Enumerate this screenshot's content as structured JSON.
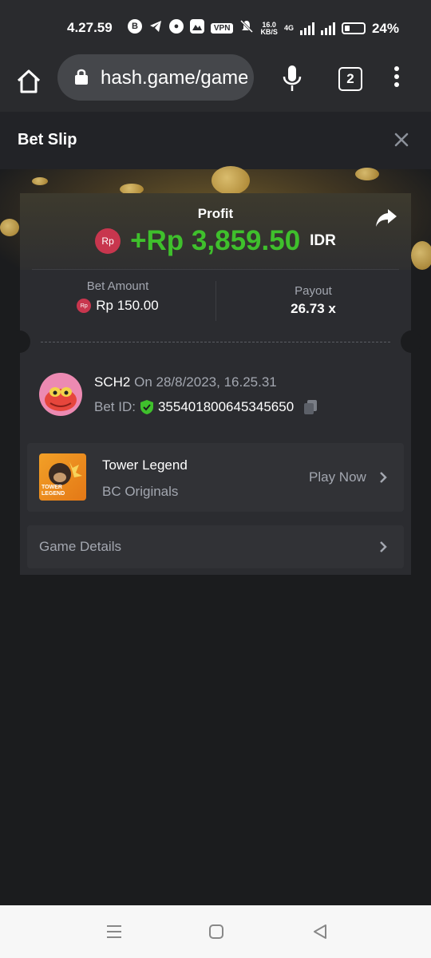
{
  "status_bar": {
    "time": "4.27.59",
    "vpn_label": "VPN",
    "speed_value": "16.0",
    "speed_unit": "KB/S",
    "network_label": "4G",
    "battery": "24%"
  },
  "browser": {
    "url": "hash.game/game",
    "tab_count": "2"
  },
  "header": {
    "title": "Bet Slip"
  },
  "card": {
    "profit_label": "Profit",
    "currency_badge": "Rp",
    "profit_amount": "+Rp 3,859.50",
    "profit_currency": "IDR",
    "bet_amount_label": "Bet Amount",
    "bet_amount_value": "Rp 150.00",
    "payout_label": "Payout",
    "payout_value": "26.73 x",
    "user": {
      "name": "SCH2",
      "date": "On 28/8/2023, 16.25.31",
      "bet_id_label": "Bet ID:",
      "bet_id_value": "355401800645345650"
    },
    "game": {
      "name": "Tower Legend",
      "provider": "BC Originals",
      "play_label": "Play Now",
      "thumb_text": "TOWER LEGEND"
    },
    "details_label": "Game Details"
  },
  "colors": {
    "profit_green": "#3fc02c",
    "currency_red": "#c8364e",
    "muted_text": "#a3a7b0"
  }
}
